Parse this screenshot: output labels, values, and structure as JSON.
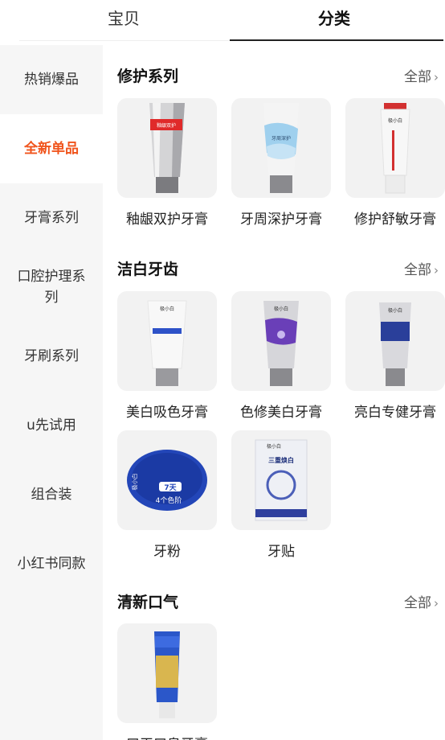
{
  "tabs": [
    {
      "label": "宝贝",
      "active": false
    },
    {
      "label": "分类",
      "active": true
    }
  ],
  "sidebar": {
    "active_color": "#f0541c",
    "items": [
      {
        "label": "热销爆品"
      },
      {
        "label": "全新单品",
        "active": true
      },
      {
        "label": "牙膏系列"
      },
      {
        "label": "口腔护理系列"
      },
      {
        "label": "牙刷系列"
      },
      {
        "label": "u先试用"
      },
      {
        "label": "组合装"
      },
      {
        "label": "小红书同款"
      }
    ]
  },
  "sections": [
    {
      "title": "修护系列",
      "all_label": "全部",
      "products": [
        {
          "name": "釉龈双护牙膏",
          "image": "silver-red-tube",
          "pack_text": [
            "釉龈双护"
          ]
        },
        {
          "name": "牙周深护牙膏",
          "image": "blue-wave-tube",
          "pack_text": [
            "牙周深护"
          ]
        },
        {
          "name": "修护舒敏牙膏",
          "image": "white-red-tube",
          "pack_text": [
            "极小白"
          ]
        }
      ]
    },
    {
      "title": "洁白牙齿",
      "all_label": "全部",
      "products": [
        {
          "name": "美白吸色牙膏",
          "image": "white-blue-tube",
          "pack_text": [
            "极小白"
          ]
        },
        {
          "name": "色修美白牙膏",
          "image": "purple-silver-tube",
          "pack_text": [
            "极小白"
          ]
        },
        {
          "name": "亮白专健牙膏",
          "image": "navy-silver-tube",
          "pack_text": [
            "极小白"
          ]
        },
        {
          "name": "牙粉",
          "image": "blue-powder-jar",
          "pack_text": [
            "极小白",
            "7天",
            "4个色阶"
          ]
        },
        {
          "name": "牙贴",
          "image": "white-strip-box",
          "pack_text": [
            "极小白",
            "三重焕白"
          ]
        }
      ]
    },
    {
      "title": "清新口气",
      "all_label": "全部",
      "products": [
        {
          "name": "口干口臭牙膏",
          "image": "gold-blue-tube",
          "pack_text": []
        }
      ]
    }
  ],
  "icons": {
    "chevron": "chevron-right-icon"
  }
}
